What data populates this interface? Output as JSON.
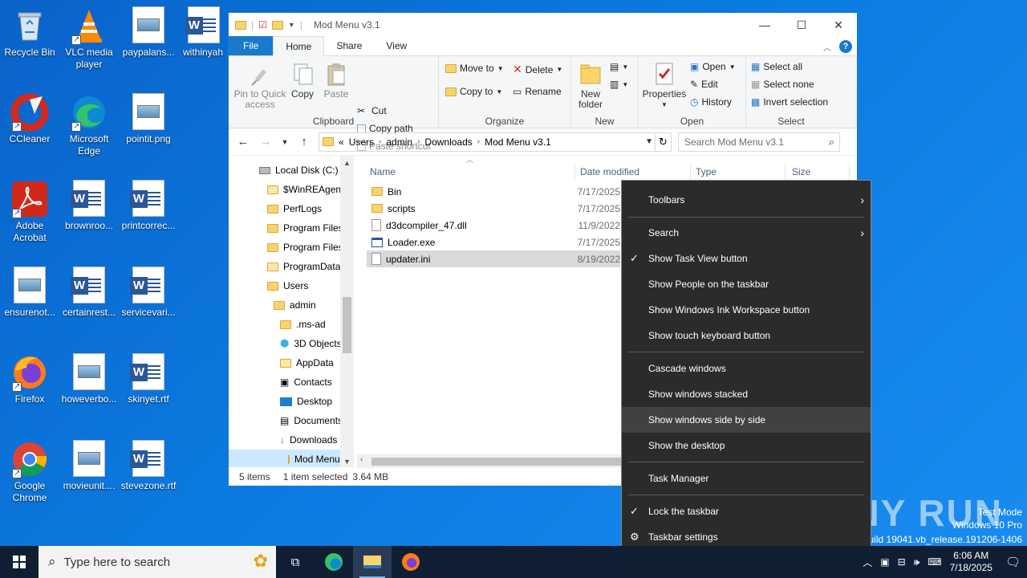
{
  "desktop": {
    "icons": [
      {
        "label": "Recycle Bin"
      },
      {
        "label": "VLC media player"
      },
      {
        "label": "paypalans..."
      },
      {
        "label": "withinyah"
      },
      {
        "label": "CCleaner"
      },
      {
        "label": "Microsoft Edge"
      },
      {
        "label": "pointit.png"
      },
      {
        "label": "Adobe Acrobat"
      },
      {
        "label": "brownroo..."
      },
      {
        "label": "printcorrec..."
      },
      {
        "label": "ensurenot..."
      },
      {
        "label": "certainrest..."
      },
      {
        "label": "servicevari..."
      },
      {
        "label": "Firefox"
      },
      {
        "label": "howeverbo..."
      },
      {
        "label": "skinyet.rtf"
      },
      {
        "label": "Google Chrome"
      },
      {
        "label": "movieunit...."
      },
      {
        "label": "stevezone.rtf"
      }
    ]
  },
  "explorer": {
    "title": "Mod Menu v3.1",
    "tabs": {
      "file": "File",
      "home": "Home",
      "share": "Share",
      "view": "View"
    },
    "ribbon": {
      "clipboard": {
        "label": "Clipboard",
        "pin": "Pin to Quick access",
        "copy": "Copy",
        "paste": "Paste",
        "cut": "Cut",
        "copy_path": "Copy path",
        "paste_shortcut": "Paste shortcut"
      },
      "organize": {
        "label": "Organize",
        "move_to": "Move to",
        "copy_to": "Copy to",
        "delete": "Delete",
        "rename": "Rename"
      },
      "new": {
        "label": "New",
        "new_folder": "New folder"
      },
      "open": {
        "label": "Open",
        "properties": "Properties",
        "open": "Open",
        "edit": "Edit",
        "history": "History"
      },
      "select": {
        "label": "Select",
        "select_all": "Select all",
        "select_none": "Select none",
        "invert": "Invert selection"
      }
    },
    "address": {
      "prefix": "«",
      "crumbs": [
        "Users",
        "admin",
        "Downloads",
        "Mod Menu v3.1"
      ],
      "search_placeholder": "Search Mod Menu v3.1"
    },
    "tree": [
      {
        "label": "Local Disk (C:)"
      },
      {
        "label": "$WinREAgent"
      },
      {
        "label": "PerfLogs"
      },
      {
        "label": "Program Files"
      },
      {
        "label": "Program Files"
      },
      {
        "label": "ProgramData"
      },
      {
        "label": "Users"
      },
      {
        "label": "admin"
      },
      {
        "label": ".ms-ad"
      },
      {
        "label": "3D Objects"
      },
      {
        "label": "AppData"
      },
      {
        "label": "Contacts"
      },
      {
        "label": "Desktop"
      },
      {
        "label": "Documents"
      },
      {
        "label": "Downloads"
      },
      {
        "label": "Mod Menu v3.1"
      }
    ],
    "columns": {
      "name": "Name",
      "date": "Date modified",
      "type": "Type",
      "size": "Size"
    },
    "files": [
      {
        "name": "Bin",
        "date": "7/17/2025"
      },
      {
        "name": "scripts",
        "date": "7/17/2025"
      },
      {
        "name": "d3dcompiler_47.dll",
        "date": "11/9/2022"
      },
      {
        "name": "Loader.exe",
        "date": "7/17/2025"
      },
      {
        "name": "updater.ini",
        "date": "8/19/2022"
      }
    ],
    "status": {
      "count": "5 items",
      "selected": "1 item selected",
      "size": "3.64 MB"
    }
  },
  "context_menu": {
    "items": [
      {
        "label": "Toolbars"
      },
      {
        "label": "Search"
      },
      {
        "label": "Show Task View button"
      },
      {
        "label": "Show People on the taskbar"
      },
      {
        "label": "Show Windows Ink Workspace button"
      },
      {
        "label": "Show touch keyboard button"
      },
      {
        "label": "Cascade windows"
      },
      {
        "label": "Show windows stacked"
      },
      {
        "label": "Show windows side by side"
      },
      {
        "label": "Show the desktop"
      },
      {
        "label": "Task Manager"
      },
      {
        "label": "Lock the taskbar"
      },
      {
        "label": "Taskbar settings"
      }
    ]
  },
  "watermark": {
    "brand": "ANY RUN",
    "line1": "Test Mode",
    "line2": "Windows 10 Pro",
    "line3": "Build 19041.vb_release.191206-1406"
  },
  "taskbar": {
    "search_placeholder": "Type here to search",
    "time": "6:06 AM",
    "date": "7/18/2025"
  }
}
